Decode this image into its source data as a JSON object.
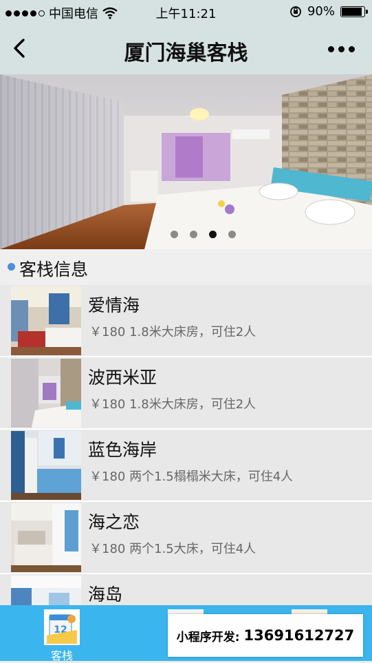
{
  "status_bar": {
    "carrier": "中国电信",
    "time": "上午11:21",
    "battery": "90%",
    "battery_level": 0.9
  },
  "nav": {
    "title": "厦门海巢客栈",
    "back_icon": "chevron-left-icon",
    "more_icon": "more-dots-icon"
  },
  "banner": {
    "page_count": 4,
    "active_index": 2
  },
  "section": {
    "title": "客栈信息"
  },
  "rooms": [
    {
      "name": "爱情海",
      "desc": "￥180 1.8米大床房，可住2人"
    },
    {
      "name": "波西米亚",
      "desc": "￥180 1.8米大床房，可住2人"
    },
    {
      "name": "蓝色海岸",
      "desc": "￥180 两个1.5榻榻米大床，可住4人"
    },
    {
      "name": "海之恋",
      "desc": "￥180 两个1.5大床，可住4人"
    },
    {
      "name": "海岛",
      "desc": ""
    }
  ],
  "tabbar": {
    "tabs": [
      {
        "label": "客栈",
        "icon": "calendar-icon"
      },
      {
        "label": "",
        "icon": "tab-icon-2"
      },
      {
        "label": "",
        "icon": "tab-icon-3"
      }
    ],
    "accent": "#3bb5ee"
  },
  "promo": {
    "label": "小程序开发:",
    "phone": "13691612727"
  }
}
